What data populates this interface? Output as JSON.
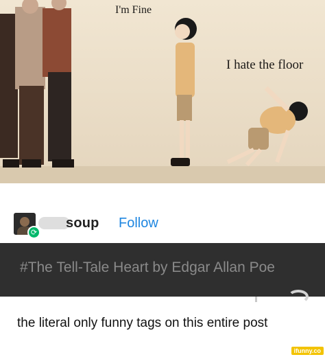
{
  "meme": {
    "caption_left": "I'm Fine",
    "caption_right": "I hate the floor"
  },
  "post": {
    "username": "soup",
    "follow_label": "Follow",
    "tag": "#The Tell-Tale Heart by Edgar Allan Poe",
    "comment": "the literal only funny tags on this entire post"
  },
  "watermark": "ifunny.co",
  "colors": {
    "follow": "#1e86e0",
    "tag_bar": "#2f2f2f",
    "tag_text": "#8a8a8a",
    "reblog_badge": "#00b86b"
  },
  "icons": {
    "reblog": "reblog-icon"
  }
}
